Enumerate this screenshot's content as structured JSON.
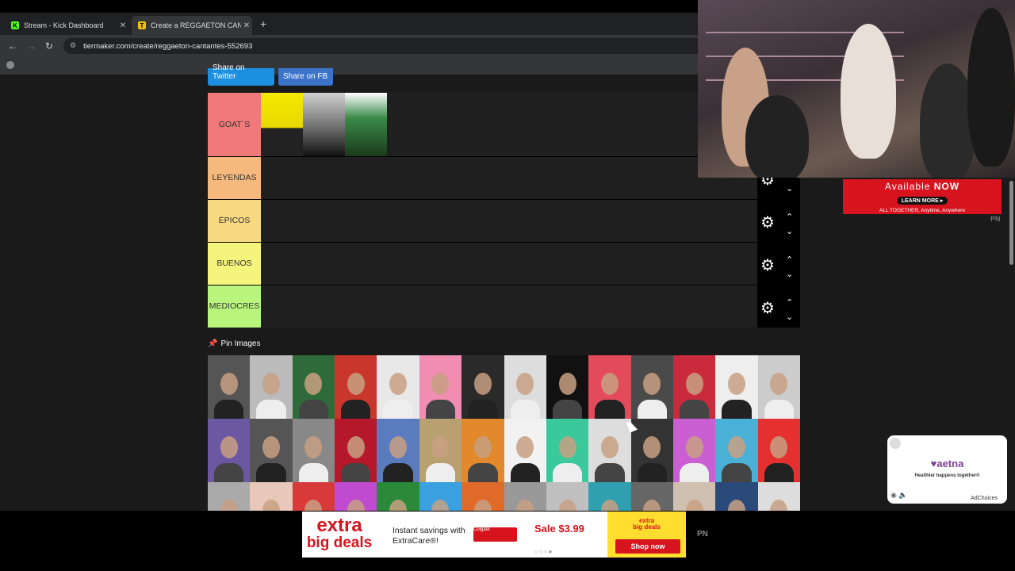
{
  "browser": {
    "tabs": [
      {
        "title": "Stream - Kick Dashboard",
        "icon": "kick-icon",
        "color": "#53fc18"
      },
      {
        "title": "Create a REGGAETON CANTAN",
        "icon": "tiermaker-icon",
        "color": "#f0c30f"
      }
    ],
    "url": "tiermaker.com/create/reggaeton-cantantes-552693"
  },
  "share": {
    "twitter": "Share on Twitter",
    "fb": "Share on FB"
  },
  "tiers": [
    {
      "label": "GOAT´S",
      "color": "#f07a7a",
      "images": [
        "daddy-yankee",
        "don-omar",
        "tego-calderon"
      ]
    },
    {
      "label": "LEYENDAS",
      "color": "#f5b87d",
      "images": []
    },
    {
      "label": "ÉPICOS",
      "color": "#f7d982",
      "images": []
    },
    {
      "label": "BUENOS",
      "color": "#f5f57d",
      "images": []
    },
    {
      "label": "MEDIOCRES",
      "color": "#b9f57d",
      "images": []
    }
  ],
  "pin_images_label": "Pin Images",
  "pool_colors": [
    "#555",
    "#bbb",
    "#2f6a3a",
    "#c9372c",
    "#e8e8e8",
    "#f08db0",
    "#2a2a2a",
    "#ddd",
    "#111",
    "#e44b5a",
    "#4a4a4a",
    "#c92b3c",
    "#eee",
    "#ccc",
    "#6b57a2",
    "#555",
    "#888",
    "#b5182b",
    "#5a7bbd",
    "#b9a070",
    "#e1892c",
    "#f2f2f2",
    "#39c99a",
    "#ddd",
    "#333",
    "#c95fd3",
    "#4ab0d6",
    "#e53030",
    "#aaa",
    "#e8c8b8",
    "#d83a3a",
    "#c04ad0",
    "#2a8a3a",
    "#3aa0e0",
    "#e06a2a",
    "#999",
    "#c0c0c0",
    "#30a0b0",
    "#666",
    "#d0c0b0",
    "#2a4a7a",
    "#ddd"
  ],
  "side_ad": {
    "headline_pre": "Available",
    "headline_bold": "NOW",
    "cta": "LEARN MORE ▸",
    "footer": "ALL TOGETHER, Anytime, Anywhere",
    "tag": "PN"
  },
  "aetna_ad": {
    "logo": "♥aetna",
    "tagline": "Healthier happens together®",
    "adchoices": "AdChoices"
  },
  "bottom_ad": {
    "brand1": "extra",
    "brand2": "big deals",
    "message": "Instant savings with ExtraCare®!",
    "colgate": "Colgate",
    "sale": "Sale $3.99",
    "mini_brand1": "extra",
    "mini_brand2": "big deals",
    "shop": "Shop now",
    "tag": "PN"
  }
}
